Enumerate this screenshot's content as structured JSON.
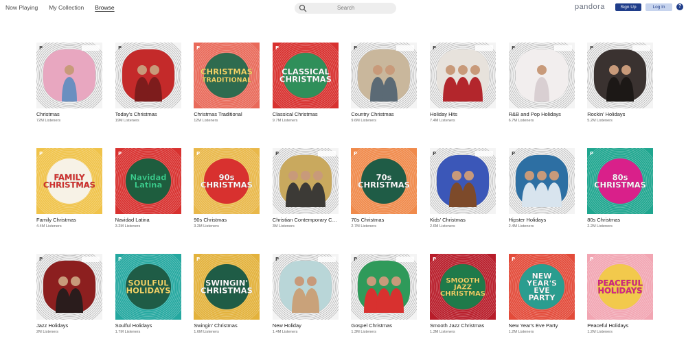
{
  "nav": {
    "now_playing": "Now Playing",
    "my_collection": "My Collection",
    "browse": "Browse"
  },
  "search": {
    "placeholder": "Search"
  },
  "logo": "pandora",
  "buttons": {
    "sign_up": "Sign Up",
    "log_in": "Log In",
    "help": "?"
  },
  "stations": [
    {
      "title": "Christmas",
      "listeners": "72M Listeners",
      "art": "photo",
      "colors": [
        "#e8a7c0",
        "#6a8fc0"
      ],
      "badge": "CHRISTMAS"
    },
    {
      "title": "Today's Christmas",
      "listeners": "19M Listeners",
      "art": "photo",
      "colors": [
        "#c42a2a",
        "#7d1c1c"
      ],
      "badge": ""
    },
    {
      "title": "Christmas Traditional",
      "listeners": "12M Listeners",
      "art": "text",
      "colors": [
        "#e96a5a",
        "#2e6b4f"
      ],
      "text": [
        "CHRISTMAS",
        "TRADITIONAL"
      ],
      "textcolor": "#f5d86a"
    },
    {
      "title": "Classical Christmas",
      "listeners": "9.7M Listeners",
      "art": "text",
      "colors": [
        "#d8312f",
        "#2f8f5a"
      ],
      "text": [
        "CLASSICAL",
        "CHRISTMAS"
      ],
      "textcolor": "#ffffff"
    },
    {
      "title": "Country Christmas",
      "listeners": "9.6M Listeners",
      "art": "photo",
      "colors": [
        "#c9b79c",
        "#5b6a75"
      ],
      "badge": "COUNTRY CHRISTMAS"
    },
    {
      "title": "Holiday Hits",
      "listeners": "7.4M Listeners",
      "art": "photo",
      "colors": [
        "#e7e2dc",
        "#b3262c"
      ],
      "badge": "HOLIDAY HITS"
    },
    {
      "title": "R&B and Pop Holidays",
      "listeners": "6.7M Listeners",
      "art": "photo",
      "colors": [
        "#f2eeee",
        "#d9cfd2"
      ],
      "badge": "R&B AND POP HOLIDAY"
    },
    {
      "title": "Rockin' Holidays",
      "listeners": "5.2M Listeners",
      "art": "photo",
      "colors": [
        "#3a3230",
        "#1c1816"
      ],
      "badge": "ROCKIN' HOLIDAYS"
    },
    {
      "title": "Family Christmas",
      "listeners": "4.4M Listeners",
      "art": "text",
      "colors": [
        "#f0c34a",
        "#f7f2e6"
      ],
      "text": [
        "FAMILY",
        "CHRISTMAS"
      ],
      "textcolor": "#d8312f"
    },
    {
      "title": "Navidad Latina",
      "listeners": "3.2M Listeners",
      "art": "text",
      "colors": [
        "#d8312f",
        "#1e5d3e"
      ],
      "text": [
        "Navidad",
        "Latina"
      ],
      "textcolor": "#3ccf8e"
    },
    {
      "title": "90s Christmas",
      "listeners": "3.2M Listeners",
      "art": "text",
      "colors": [
        "#e9b84a",
        "#d8312f"
      ],
      "text": [
        "90s",
        "CHRISTMAS"
      ],
      "textcolor": "#ffffff"
    },
    {
      "title": "Christian Contemporary Christmas",
      "listeners": "3M Listeners",
      "art": "photo",
      "colors": [
        "#c9a95e",
        "#3c3a36"
      ],
      "badge": "CHRISTIAN CONTEMPORARY"
    },
    {
      "title": "70s Christmas",
      "listeners": "2.7M Listeners",
      "art": "text",
      "colors": [
        "#f08a4b",
        "#1f5c46"
      ],
      "text": [
        "70s",
        "CHRISTMAS"
      ],
      "textcolor": "#ffffff"
    },
    {
      "title": "Kids' Christmas",
      "listeners": "2.6M Listeners",
      "art": "photo",
      "colors": [
        "#3b57b8",
        "#7d4a2a"
      ],
      "badge": "KIDS' CHRISTMAS"
    },
    {
      "title": "Hipster Holidays",
      "listeners": "2.4M Listeners",
      "art": "photo",
      "colors": [
        "#2d6fa3",
        "#d8e4ee"
      ],
      "badge": ""
    },
    {
      "title": "80s Christmas",
      "listeners": "2.2M Listeners",
      "art": "text",
      "colors": [
        "#1fa68f",
        "#d9208a"
      ],
      "text": [
        "80s",
        "CHRISTMAS"
      ],
      "textcolor": "#ffffff"
    },
    {
      "title": "Jazz Holidays",
      "listeners": "2M Listeners",
      "art": "photo",
      "colors": [
        "#8c1f1f",
        "#2a1c1c"
      ],
      "badge": "JAZZ HOLIDAYS"
    },
    {
      "title": "Soulful Holidays",
      "listeners": "1.7M Listeners",
      "art": "text",
      "colors": [
        "#25a8a0",
        "#1f5c46"
      ],
      "text": [
        "SOULFUL",
        "HOLIDAYS"
      ],
      "textcolor": "#f5d86a"
    },
    {
      "title": "Swingin' Christmas",
      "listeners": "1.6M Listeners",
      "art": "text",
      "colors": [
        "#e3b23c",
        "#1f5c46"
      ],
      "text": [
        "SWINGIN'",
        "CHRISTMAS"
      ],
      "textcolor": "#ffffff"
    },
    {
      "title": "New Holiday",
      "listeners": "1.4M Listeners",
      "art": "photo",
      "colors": [
        "#b9d6d8",
        "#c9a27a"
      ],
      "badge": "NEW HOLIDAY"
    },
    {
      "title": "Gospel Christmas",
      "listeners": "1.3M Listeners",
      "art": "photo",
      "colors": [
        "#2f9a5a",
        "#d8312f"
      ],
      "badge": "GOSPEL CHRISTMAS"
    },
    {
      "title": "Smooth Jazz Christmas",
      "listeners": "1.3M Listeners",
      "art": "text",
      "colors": [
        "#b81d2a",
        "#1f7a4a"
      ],
      "text": [
        "SMOOTH",
        "JAZZ",
        "CHRISTMAS"
      ],
      "textcolor": "#f5d86a"
    },
    {
      "title": "New Year's Eve Party",
      "listeners": "1.2M Listeners",
      "art": "text",
      "colors": [
        "#e34b3a",
        "#2a9d8f"
      ],
      "text": [
        "NEW",
        "YEAR'S",
        "EVE",
        "PARTY"
      ],
      "textcolor": "#ffffff"
    },
    {
      "title": "Peaceful Holidays",
      "listeners": "1.2M Listeners",
      "art": "text",
      "colors": [
        "#f2a6b3",
        "#f2c94c"
      ],
      "text": [
        "PEACEFUL",
        "HOLIDAYS"
      ],
      "textcolor": "#d9208a"
    }
  ]
}
